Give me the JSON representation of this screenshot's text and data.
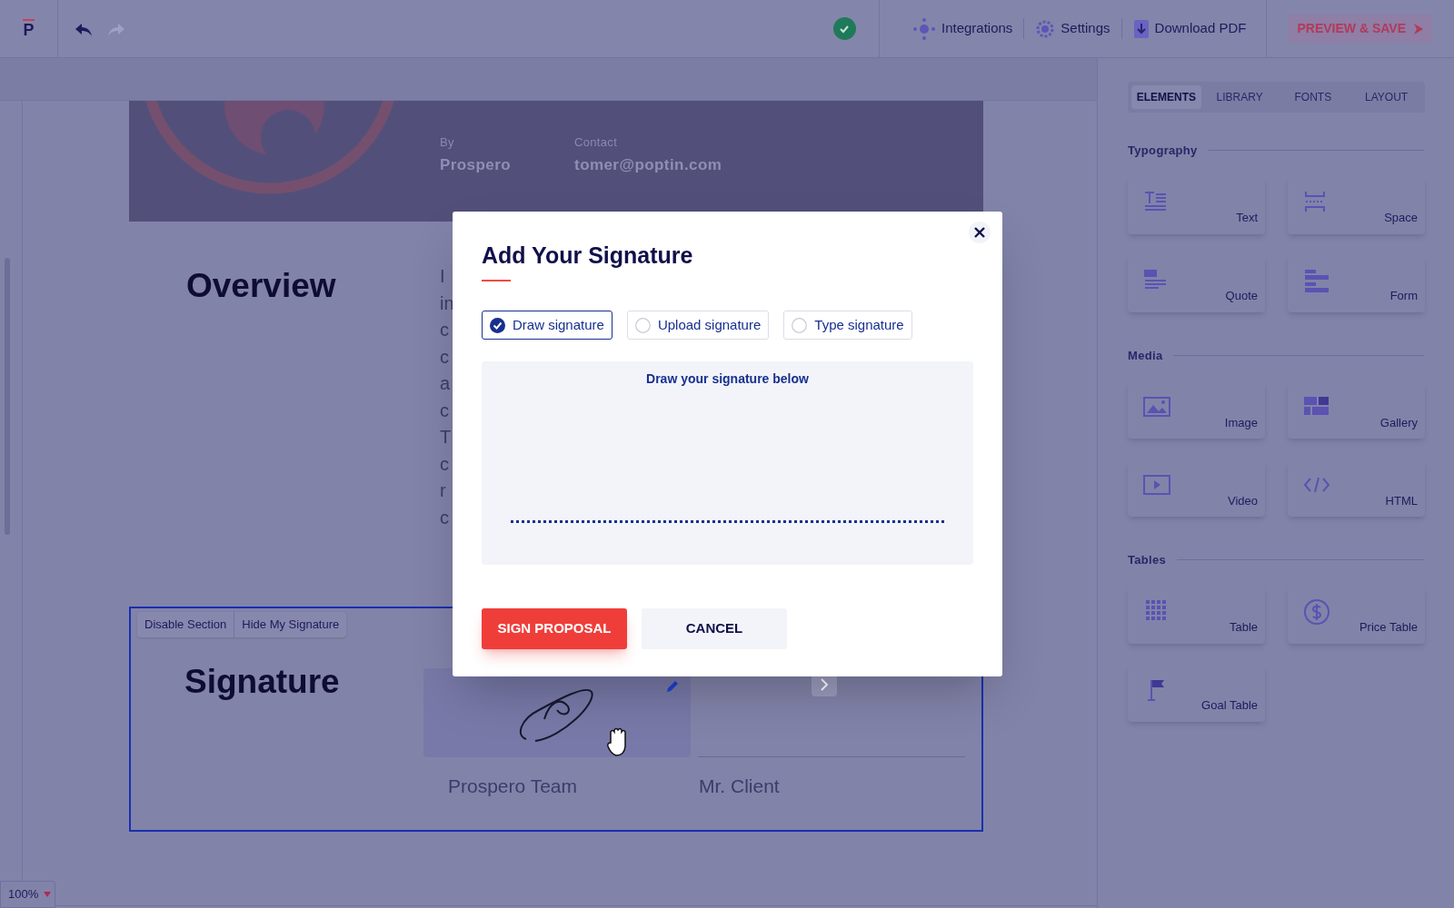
{
  "toolbar": {
    "logo": "P",
    "history": [
      {
        "kind": "undo",
        "disabled": false
      },
      {
        "kind": "redo",
        "disabled": true
      }
    ],
    "saved": true,
    "actions": [
      {
        "kind": "integrations",
        "label": "Integrations"
      },
      {
        "kind": "settings",
        "label": "Settings"
      },
      {
        "kind": "download",
        "label": "Download PDF"
      }
    ],
    "preview": "PREVIEW & SAVE"
  },
  "document": {
    "header": {
      "fields": [
        {
          "label": "By",
          "value": "Prospero"
        },
        {
          "label": "Contact",
          "value": "tomer@poptin.com"
        }
      ]
    },
    "overview": {
      "heading": "Overview",
      "text_lines": [
        "I",
        "in",
        "c",
        "c",
        "a",
        "c",
        "T",
        "c",
        "r",
        "c"
      ]
    },
    "signature_section": {
      "actions": [
        "Disable Section",
        "Hide My Signature"
      ],
      "heading": "Signature",
      "signers": [
        {
          "name": "Prospero Team",
          "signed": true
        },
        {
          "name": "Mr. Client",
          "signed": false
        }
      ]
    }
  },
  "zoom": "100%",
  "panel": {
    "tabs": [
      {
        "label": "ELEMENTS",
        "selected": true
      },
      {
        "label": "LIBRARY",
        "selected": false
      },
      {
        "label": "FONTS",
        "selected": false
      },
      {
        "label": "LAYOUT",
        "selected": false
      }
    ],
    "sections": [
      {
        "title": "Typography",
        "items": [
          {
            "label": "Text",
            "kind": "text"
          },
          {
            "label": "Space",
            "kind": "space"
          },
          {
            "label": "Quote",
            "kind": "quote"
          },
          {
            "label": "Form",
            "kind": "form"
          }
        ]
      },
      {
        "title": "Media",
        "items": [
          {
            "label": "Image",
            "kind": "image"
          },
          {
            "label": "Gallery",
            "kind": "gallery"
          },
          {
            "label": "Video",
            "kind": "video"
          },
          {
            "label": "HTML",
            "kind": "html"
          }
        ]
      },
      {
        "title": "Tables",
        "items": [
          {
            "label": "Table",
            "kind": "table"
          },
          {
            "label": "Price Table",
            "kind": "price"
          },
          {
            "label": "Goal Table",
            "kind": "goal"
          }
        ]
      }
    ]
  },
  "modal": {
    "title": "Add Your Signature",
    "options": [
      {
        "label": "Draw signature",
        "selected": true
      },
      {
        "label": "Upload signature",
        "selected": false
      },
      {
        "label": "Type signature",
        "selected": false
      }
    ],
    "draw_hint": "Draw your signature below",
    "buttons": [
      {
        "label": "SIGN PROPOSAL",
        "kind": "primary"
      },
      {
        "label": "CANCEL",
        "kind": "secondary"
      }
    ]
  }
}
